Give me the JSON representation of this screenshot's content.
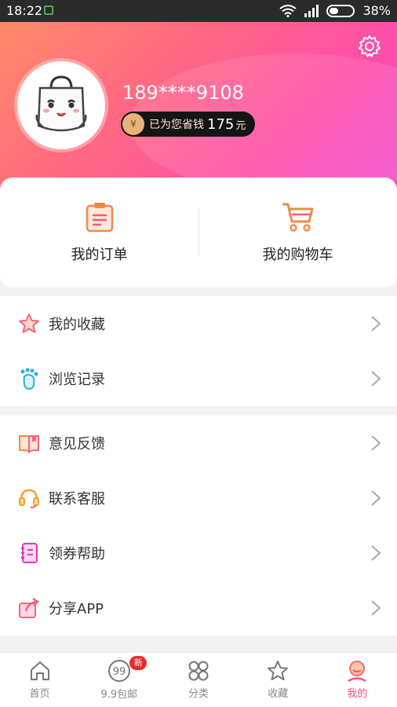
{
  "status_bar": {
    "time": "18:22",
    "battery": "38%"
  },
  "profile": {
    "phone": "189****9108",
    "savings_prefix": "已为您省钱",
    "savings_amount": "175",
    "savings_unit": "元"
  },
  "quick_actions": [
    {
      "label": "我的订单",
      "icon": "order-clipboard-icon"
    },
    {
      "label": "我的购物车",
      "icon": "shopping-cart-icon"
    }
  ],
  "menu_group_1": [
    {
      "label": "我的收藏",
      "icon": "star-icon"
    },
    {
      "label": "浏览记录",
      "icon": "footprint-icon"
    }
  ],
  "menu_group_2": [
    {
      "label": "意见反馈",
      "icon": "book-feedback-icon"
    },
    {
      "label": "联系客服",
      "icon": "headset-icon"
    },
    {
      "label": "领券帮助",
      "icon": "notebook-icon"
    },
    {
      "label": "分享APP",
      "icon": "share-icon"
    }
  ],
  "tabbar": [
    {
      "label": "首页",
      "icon": "home-icon"
    },
    {
      "label": "9.9包邮",
      "icon": "nine-nine-icon",
      "badge": "新"
    },
    {
      "label": "分类",
      "icon": "category-icon"
    },
    {
      "label": "收藏",
      "icon": "star-outline-icon"
    },
    {
      "label": "我的",
      "icon": "user-icon",
      "active": true
    }
  ],
  "colors": {
    "accent": "#ff4f7a",
    "header_start": "#ff8a68",
    "header_end": "#f34fd0"
  }
}
